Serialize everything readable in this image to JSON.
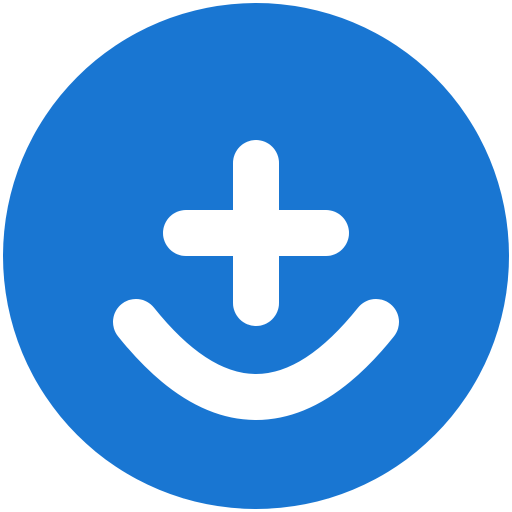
{
  "logo": {
    "icon": "plus-smile-logo-icon",
    "colors": {
      "circle": "#1976D2",
      "glyph": "#FFFFFF",
      "background": "#FFFFFF"
    }
  }
}
